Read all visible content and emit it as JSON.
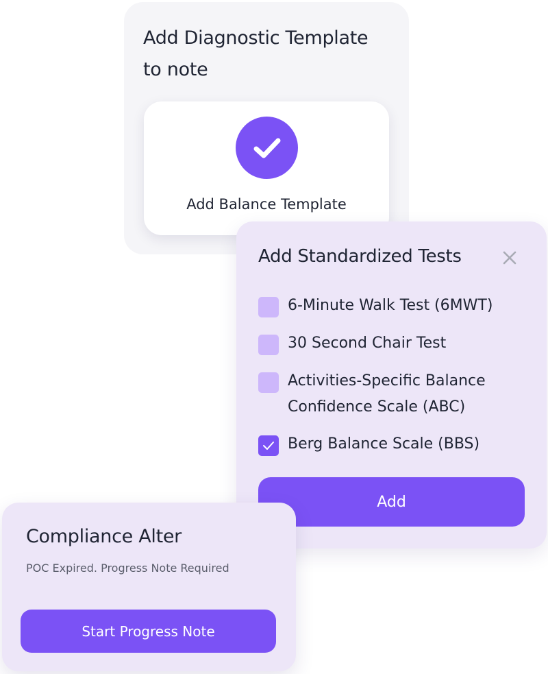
{
  "diagnostic": {
    "title": "Add Diagnostic Template to note",
    "option": {
      "label": "Add Balance Template",
      "icon": "check-icon",
      "selected": true
    }
  },
  "standardized_tests": {
    "title": "Add Standardized Tests",
    "close_icon": "close-icon",
    "items": [
      {
        "label": "6-Minute Walk Test (6MWT)",
        "checked": false
      },
      {
        "label": "30 Second Chair Test",
        "checked": false
      },
      {
        "label": "Activities-Specific Balance Confidence Scale (ABC)",
        "checked": false
      },
      {
        "label": "Berg Balance Scale (BBS)",
        "checked": true
      }
    ],
    "add_label": "Add"
  },
  "compliance": {
    "title": "Compliance Alter",
    "message": "POC Expired. Progress Note Required",
    "button_label": "Start Progress Note"
  },
  "colors": {
    "accent": "#7b52f5",
    "checkbox_unchecked": "#cdb7fb",
    "panel_lilac": "#ede6f8",
    "panel_grey": "#f5f5f8"
  }
}
